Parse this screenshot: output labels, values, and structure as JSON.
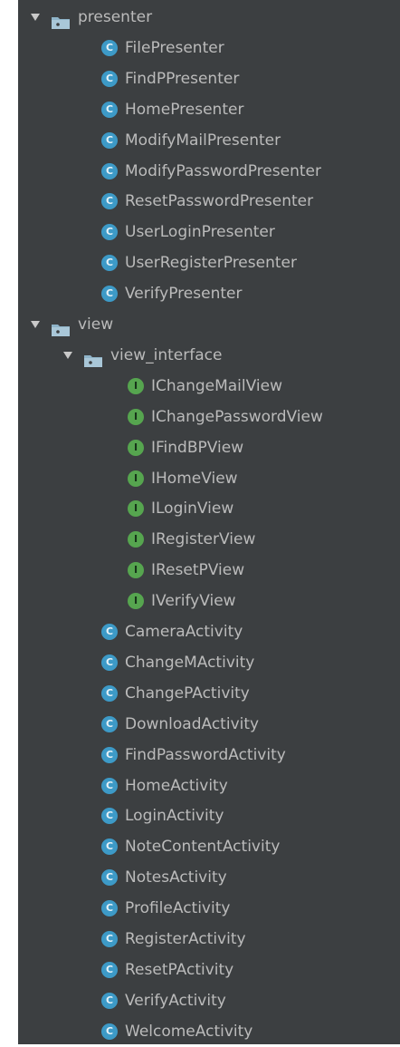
{
  "colors": {
    "panel_bg": "#3c3f41",
    "text": "#bbbbbb",
    "class_badge": "#3d9ac7",
    "interface_badge": "#56a54f",
    "folder": "#8fb4c9"
  },
  "tree": [
    {
      "type": "folder",
      "depth": 0,
      "label": "presenter",
      "expanded": true
    },
    {
      "type": "class",
      "depth": 1,
      "label": "FilePresenter",
      "badge": "C"
    },
    {
      "type": "class",
      "depth": 1,
      "label": "FindPPresenter",
      "badge": "C"
    },
    {
      "type": "class",
      "depth": 1,
      "label": "HomePresenter",
      "badge": "C"
    },
    {
      "type": "class",
      "depth": 1,
      "label": "ModifyMailPresenter",
      "badge": "C"
    },
    {
      "type": "class",
      "depth": 1,
      "label": "ModifyPasswordPresenter",
      "badge": "C"
    },
    {
      "type": "class",
      "depth": 1,
      "label": "ResetPasswordPresenter",
      "badge": "C"
    },
    {
      "type": "class",
      "depth": 1,
      "label": "UserLoginPresenter",
      "badge": "C"
    },
    {
      "type": "class",
      "depth": 1,
      "label": "UserRegisterPresenter",
      "badge": "C"
    },
    {
      "type": "class",
      "depth": 1,
      "label": "VerifyPresenter",
      "badge": "C"
    },
    {
      "type": "folder",
      "depth": 0,
      "label": "view",
      "expanded": true
    },
    {
      "type": "folder",
      "depth": 1,
      "label": "view_interface",
      "expanded": true
    },
    {
      "type": "interface",
      "depth": 2,
      "label": "IChangeMailView",
      "badge": "I"
    },
    {
      "type": "interface",
      "depth": 2,
      "label": "IChangePasswordView",
      "badge": "I"
    },
    {
      "type": "interface",
      "depth": 2,
      "label": "IFindBPView",
      "badge": "I"
    },
    {
      "type": "interface",
      "depth": 2,
      "label": "IHomeView",
      "badge": "I"
    },
    {
      "type": "interface",
      "depth": 2,
      "label": "ILoginView",
      "badge": "I"
    },
    {
      "type": "interface",
      "depth": 2,
      "label": "IRegisterView",
      "badge": "I"
    },
    {
      "type": "interface",
      "depth": 2,
      "label": "IResetPView",
      "badge": "I"
    },
    {
      "type": "interface",
      "depth": 2,
      "label": "IVerifyView",
      "badge": "I"
    },
    {
      "type": "class",
      "depth": 1,
      "label": "CameraActivity",
      "badge": "C"
    },
    {
      "type": "class",
      "depth": 1,
      "label": "ChangeMActivity",
      "badge": "C"
    },
    {
      "type": "class",
      "depth": 1,
      "label": "ChangePActivity",
      "badge": "C"
    },
    {
      "type": "class",
      "depth": 1,
      "label": "DownloadActivity",
      "badge": "C"
    },
    {
      "type": "class",
      "depth": 1,
      "label": "FindPasswordActivity",
      "badge": "C"
    },
    {
      "type": "class",
      "depth": 1,
      "label": "HomeActivity",
      "badge": "C"
    },
    {
      "type": "class",
      "depth": 1,
      "label": "LoginActivity",
      "badge": "C"
    },
    {
      "type": "class",
      "depth": 1,
      "label": "NoteContentActivity",
      "badge": "C"
    },
    {
      "type": "class",
      "depth": 1,
      "label": "NotesActivity",
      "badge": "C"
    },
    {
      "type": "class",
      "depth": 1,
      "label": "ProfileActivity",
      "badge": "C"
    },
    {
      "type": "class",
      "depth": 1,
      "label": "RegisterActivity",
      "badge": "C"
    },
    {
      "type": "class",
      "depth": 1,
      "label": "ResetPActivity",
      "badge": "C"
    },
    {
      "type": "class",
      "depth": 1,
      "label": "VerifyActivity",
      "badge": "C"
    },
    {
      "type": "class",
      "depth": 1,
      "label": "WelcomeActivity",
      "badge": "C"
    }
  ]
}
